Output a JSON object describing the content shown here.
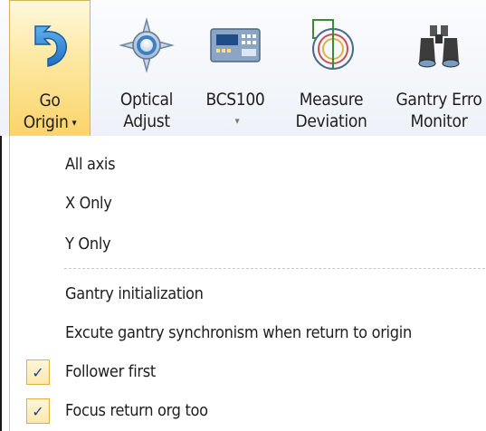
{
  "ribbon": {
    "buttons": [
      {
        "name": "go-origin-button",
        "line1": "Go",
        "line2": "Origin",
        "icon": "undo-arrow-icon",
        "dropdown": true
      },
      {
        "name": "optical-adjust-button",
        "line1": "Optical",
        "line2": "Adjust",
        "icon": "compass-icon"
      },
      {
        "name": "bcs100-button",
        "line1": "BCS100",
        "line2": "",
        "icon": "controller-panel-icon",
        "dropdown": true
      },
      {
        "name": "measure-deviation-button",
        "line1": "Measure",
        "line2": "Deviation",
        "icon": "measure-circle-icon"
      },
      {
        "name": "gantry-error-monitor-button",
        "line1": "Gantry Erro",
        "line2": "Monitor",
        "icon": "binoculars-icon"
      }
    ],
    "dropdown_arrow": "▾"
  },
  "menu": {
    "items": [
      {
        "label": "All axis",
        "checked": false
      },
      {
        "label": "X Only",
        "checked": false
      },
      {
        "label": "Y Only",
        "checked": false
      },
      {
        "label": "Gantry initialization",
        "checked": false
      },
      {
        "label": "Excute gantry synchronism when return to origin",
        "checked": false
      },
      {
        "label": "Follower first",
        "checked": true
      },
      {
        "label": "Focus return org too",
        "checked": true
      }
    ],
    "check_glyph": "✓"
  },
  "colors": {
    "accent_blue": "#2c7fd0",
    "highlight_gold": "#fbd46a",
    "check_color": "#1f3f8c"
  }
}
